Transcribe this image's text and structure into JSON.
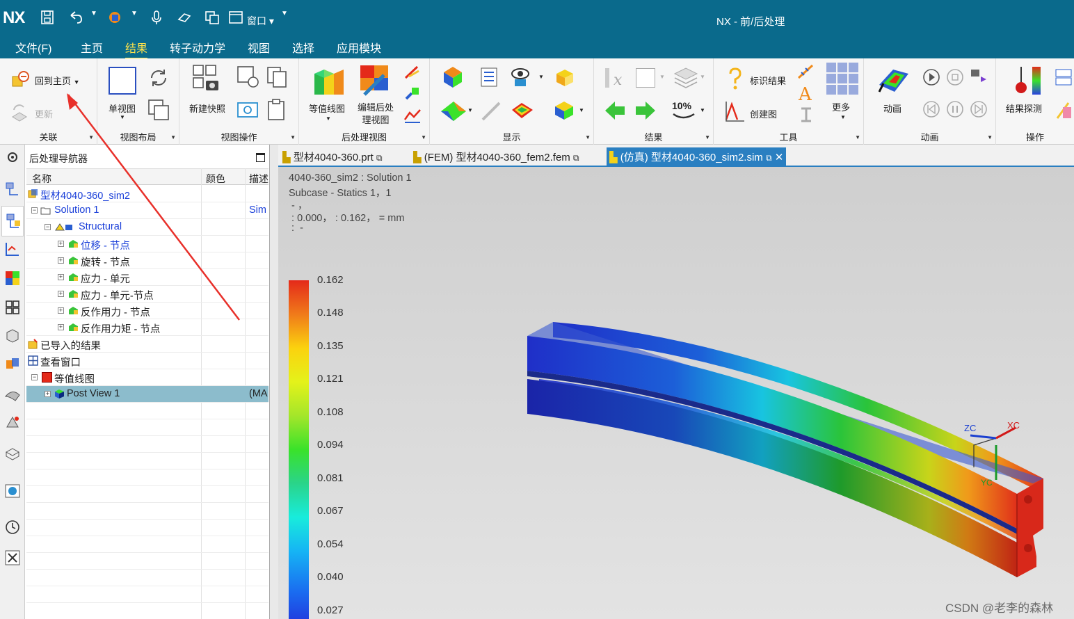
{
  "app": {
    "logo": "NX",
    "window_title": "NX - 前/后处理",
    "window_menu": "窗口"
  },
  "menu": [
    "文件(F)",
    "主页",
    "结果",
    "转子动力学",
    "视图",
    "选择",
    "应用模块"
  ],
  "ribbon": {
    "groups": [
      "关联",
      "视图布局",
      "视图操作",
      "后处理视图",
      "显示",
      "结果",
      "工具",
      "动画",
      "操作"
    ],
    "return_home": "回到主页",
    "update": "更新",
    "single_view": "单视图",
    "new_snapshot": "新建快照",
    "contour_plot": "等值线图",
    "edit_post_view": "编辑后处理视图",
    "identify_results": "标识结果",
    "create_graph": "创建图",
    "more": "更多",
    "animation": "动画",
    "result_probe": "结果探测",
    "percent": "10%"
  },
  "navigator": {
    "title": "后处理导航器",
    "columns": [
      "名称",
      "颜色",
      "描述"
    ],
    "rows": [
      {
        "label": "型材4040-360_sim2",
        "desc": "",
        "sign": ""
      },
      {
        "label": "Solution 1",
        "desc": "Sim",
        "sign": "−"
      },
      {
        "label": "Structural",
        "desc": "",
        "sign": "−"
      },
      {
        "label": "位移 - 节点",
        "desc": "",
        "sign": "+"
      },
      {
        "label": "旋转 - 节点",
        "desc": "",
        "sign": "+"
      },
      {
        "label": "应力 - 单元",
        "desc": "",
        "sign": "+"
      },
      {
        "label": "应力 - 单元-节点",
        "desc": "",
        "sign": "+"
      },
      {
        "label": "反作用力 - 节点",
        "desc": "",
        "sign": "+"
      },
      {
        "label": "反作用力矩 - 节点",
        "desc": "",
        "sign": "+"
      },
      {
        "label": "已导入的结果",
        "desc": "",
        "sign": ""
      },
      {
        "label": "查看窗口",
        "desc": "",
        "sign": ""
      },
      {
        "label": "等值线图",
        "desc": "",
        "sign": "−"
      },
      {
        "label": "Post View 1",
        "desc": "(MA",
        "sign": "+"
      }
    ]
  },
  "doc_tabs": [
    "型材4040-360.prt",
    "(FEM) 型材4040-360_fem2.fem",
    "(仿真) 型材4040-360_sim2.sim"
  ],
  "viewport": {
    "info": [
      "4040-360_sim2 : Solution 1",
      "Subcase - Statics 1，1",
      " - ，",
      " : 0.000， : 0.162， = mm",
      " :  - "
    ],
    "legend": [
      "0.162",
      "0.148",
      "0.135",
      "0.121",
      "0.108",
      "0.094",
      "0.081",
      "0.067",
      "0.054",
      "0.040",
      "0.027"
    ],
    "axes": {
      "zc": "ZC",
      "xc": "XC",
      "yc": "YC"
    }
  },
  "watermark": "CSDN @老李的森林"
}
